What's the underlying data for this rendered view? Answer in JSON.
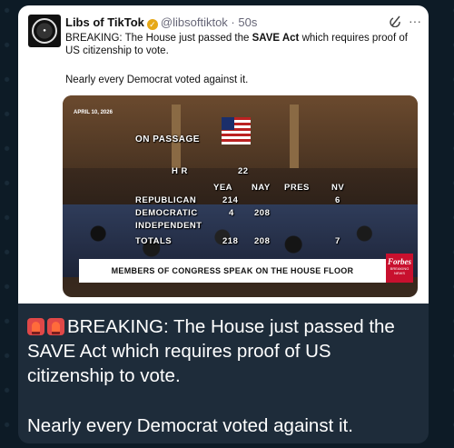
{
  "tweet": {
    "author_name": "Libs of TikTok",
    "handle_time": "@libsoftiktok · 50s",
    "text_prefix": "BREAKING: The House just passed the ",
    "text_bold": "SAVE Act",
    "text_suffix": " which requires proof of US citizenship to vote.",
    "text_2": "Nearly every Democrat voted against it.",
    "icons": {
      "avatar": "libs-of-tiktok-logo",
      "verified": "verified-badge-icon",
      "grok": "grok-icon",
      "more": "more-icon"
    }
  },
  "media": {
    "date_label": "APRIL 10, 2026",
    "on_passage": "ON PASSAGE",
    "hr": "H R",
    "hr_num": "22",
    "col_headers": [
      "YEA",
      "NAY",
      "PRES",
      "NV"
    ],
    "rows": [
      {
        "label": "REPUBLICAN",
        "yea": "214",
        "nay": "",
        "nv": "6"
      },
      {
        "label": "DEMOCRATIC",
        "yea": "4",
        "nay": "208",
        "nv": ""
      },
      {
        "label": "INDEPENDENT",
        "yea": "",
        "nay": "",
        "nv": ""
      },
      {
        "label": "TOTALS",
        "yea": "218",
        "nay": "208",
        "nv": "7"
      }
    ],
    "banner": "MEMBERS OF CONGRESS SPEAK ON THE HOUSE FLOOR",
    "forbes_name": "Forbes",
    "forbes_sub": "BREAKING NEWS"
  },
  "caption": {
    "text_1": "BREAKING: The House just passed the SAVE Act which requires proof of US citizenship to vote.",
    "text_2": "Nearly every Democrat voted against it.",
    "icons": [
      "police-light-icon",
      "police-light-icon"
    ]
  },
  "colors": {
    "bubble": "#1e2c3a",
    "forbes_red": "#c8102e",
    "verified_gold": "#e6a817"
  }
}
